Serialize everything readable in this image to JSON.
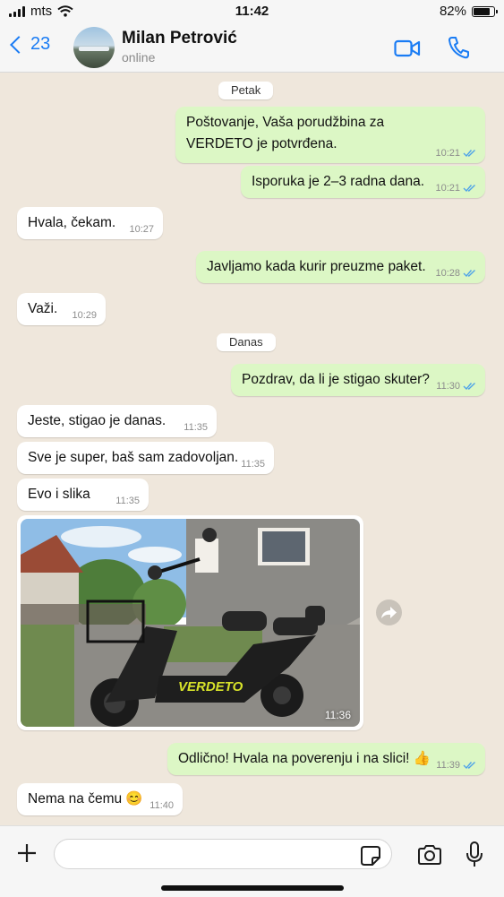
{
  "status_bar": {
    "carrier": "mts",
    "time": "11:42",
    "battery": "82%",
    "battery_level": 0.82
  },
  "header": {
    "back_count": "23",
    "contact_name": "Milan Petrović",
    "contact_status": "online"
  },
  "date_labels": {
    "friday": "Petak",
    "today": "Danas"
  },
  "messages": [
    {
      "dir": "out",
      "text": "Poštovanje, Vaša porudžbina za VERDETO je potvrđena.",
      "time": "10:21",
      "read": true
    },
    {
      "dir": "out",
      "text": "Isporuka je 2–3 radna dana.",
      "time": "10:21",
      "read": true
    },
    {
      "dir": "in",
      "text": "Hvala, čekam.",
      "time": "10:27"
    },
    {
      "dir": "out",
      "text": "Javljamo kada kurir preuzme paket.",
      "time": "10:28",
      "read": true
    },
    {
      "dir": "in",
      "text": "Važi.",
      "time": "10:29"
    },
    {
      "dir": "out",
      "text": "Pozdrav, da li je stigao skuter?",
      "time": "11:30",
      "read": true
    },
    {
      "dir": "in",
      "text": "Jeste, stigao je danas.",
      "time": "11:35"
    },
    {
      "dir": "in",
      "text": "Sve je super, baš sam zadovoljan.",
      "time": "11:35"
    },
    {
      "dir": "in",
      "text": "Evo i slika",
      "time": "11:35"
    },
    {
      "dir": "in",
      "type": "image",
      "time": "11:36",
      "brand_on_scooter": "VERDETO"
    },
    {
      "dir": "out",
      "text": "Odlično! Hvala na poverenju i na slici! 👍",
      "time": "11:39",
      "read": true
    },
    {
      "dir": "in",
      "text": "Nema na čemu 😊",
      "time": "11:40"
    }
  ],
  "input": {
    "value": "",
    "placeholder": ""
  },
  "icons": {
    "back": "chevron-left-icon",
    "video": "video-camera-icon",
    "call": "phone-icon",
    "attach": "plus-icon",
    "sticker": "sticker-icon",
    "camera": "camera-icon",
    "mic": "microphone-icon",
    "forward": "forward-icon",
    "read_receipt": "double-check-icon"
  },
  "colors": {
    "accent": "#1a7cf4",
    "outgoing_bubble": "#dcf7c5",
    "incoming_bubble": "#ffffff",
    "chat_bg": "#efe7dc",
    "read_ticks": "#4fa3e8"
  }
}
